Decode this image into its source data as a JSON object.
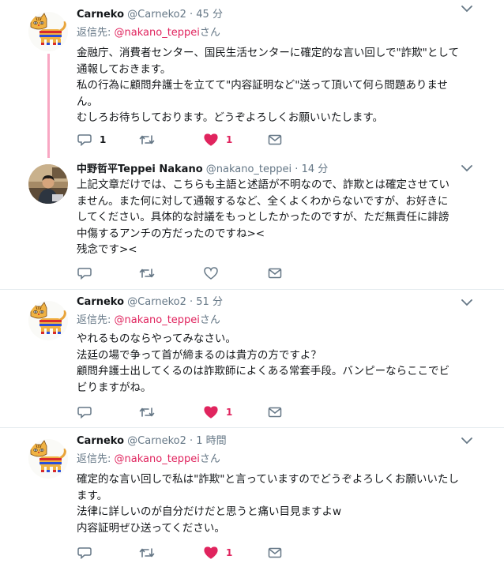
{
  "tweets": [
    {
      "name": "Carneko",
      "handle": "@Carneko2",
      "separator": "·",
      "time": "45 分",
      "reply_prefix": "返信先:",
      "reply_mention": "@nakano_teppei",
      "reply_suffix": "さん",
      "lines": [
        "金融庁、消費者センター、国民生活センターに確定的な言い回しで\"詐欺\"として",
        "通報しておきます。",
        "私の行為に顧問弁護士を立てて\"内容証明など\"送って頂いて何ら問題ありませ",
        "ん。",
        "むしろお待ちしております。どうぞよろしくお願いいたします。"
      ],
      "reply_count": "1",
      "retweet_count": "",
      "like_count": "1",
      "liked": true
    },
    {
      "name": "中野哲平Teppei Nakano",
      "handle": "@nakano_teppei",
      "separator": "·",
      "time": "14 分",
      "lines": [
        "上記文章だけでは、こちらも主語と述語が不明なので、詐欺とは確定させてい",
        "ません。また何に対して通報するなど、全くよくわからないですが、お好きに",
        "してください。具体的な討議をもっとしたかったのですが、ただ無責任に誹謗",
        "中傷するアンチの方だったのですね><",
        "残念です><"
      ],
      "reply_count": "",
      "retweet_count": "",
      "like_count": "",
      "liked": false
    },
    {
      "name": "Carneko",
      "handle": "@Carneko2",
      "separator": "·",
      "time": "51 分",
      "reply_prefix": "返信先:",
      "reply_mention": "@nakano_teppei",
      "reply_suffix": "さん",
      "lines": [
        "やれるものならやってみなさい。",
        "法廷の場で争って首が締まるのは貴方の方ですよ？",
        "顧問弁護士出してくるのは詐欺師によくある常套手段。バンピーならここでビ",
        "ビりますがね。"
      ],
      "reply_count": "",
      "retweet_count": "",
      "like_count": "1",
      "liked": true
    },
    {
      "name": "Carneko",
      "handle": "@Carneko2",
      "separator": "·",
      "time": "1 時間",
      "reply_prefix": "返信先:",
      "reply_mention": "@nakano_teppei",
      "reply_suffix": "さん",
      "lines": [
        "確定的な言い回しで私は\"詐欺\"と言っていますのでどうぞよろしくお願いいたし",
        "ます。",
        "法律に詳しいのが自分だけだと思うと痛い目見ますよw",
        "内容証明ぜひ送ってください。"
      ],
      "reply_count": "",
      "retweet_count": "",
      "like_count": "1",
      "liked": true
    }
  ],
  "icons": {
    "reply": "reply-icon",
    "retweet": "retweet-icon",
    "like": "heart-icon",
    "message": "envelope-icon",
    "menu": "chevron-down-icon",
    "avatar_carneko": "cat-avatar",
    "avatar_teppei": "person-photo-avatar"
  },
  "colors": {
    "like": "#e0245e",
    "mention": "#e0245e",
    "muted": "#657786",
    "thread_line": "#f8a7c3",
    "text": "#14171a",
    "divider": "#e6ecf0"
  }
}
